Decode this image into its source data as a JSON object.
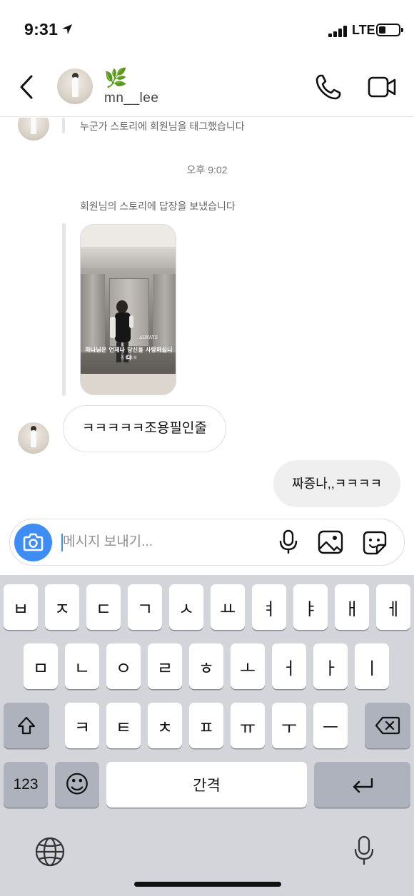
{
  "status_bar": {
    "time": "9:31",
    "network": "LTE"
  },
  "header": {
    "username": "mn__lee",
    "leaf_emoji": "🌿"
  },
  "chat": {
    "tag_notice": "누군가 스토리에 회원님을 태그했습니다",
    "timestamp": "오후 9:02",
    "reply_notice": "회원님의 스토리에 답장을 보냈습니다",
    "story_caption": "하나님은 언제나 당신을 사랑하십니다",
    "story_sub": "중 앙 대 회",
    "story_badge": "ALWAYS",
    "received_message": "ㅋㅋㅋㅋㅋ조용필인줄",
    "sent_message": "짜증나,,ㅋㅋㅋㅋ"
  },
  "composer": {
    "placeholder": "메시지 보내기..."
  },
  "keyboard": {
    "row1": [
      "ㅂ",
      "ㅈ",
      "ㄷ",
      "ㄱ",
      "ㅅ",
      "ㅛ",
      "ㅕ",
      "ㅑ",
      "ㅐ",
      "ㅔ"
    ],
    "row2": [
      "ㅁ",
      "ㄴ",
      "ㅇ",
      "ㄹ",
      "ㅎ",
      "ㅗ",
      "ㅓ",
      "ㅏ",
      "ㅣ"
    ],
    "row3": [
      "ㅋ",
      "ㅌ",
      "ㅊ",
      "ㅍ",
      "ㅠ",
      "ㅜ",
      "ㅡ"
    ],
    "numbers_key": "123",
    "space_key": "간격",
    "emoji_key": "☺"
  },
  "icons": {
    "back": "chevron-left-icon",
    "call": "phone-icon",
    "video": "video-camera-icon",
    "camera": "camera-icon",
    "mic": "microphone-icon",
    "gallery": "image-icon",
    "sticker": "sticker-icon",
    "shift": "shift-icon",
    "delete": "backspace-icon",
    "return": "return-icon",
    "globe": "globe-icon"
  },
  "colors": {
    "accent": "#3d8df5",
    "keyboard_bg": "#d3d5db",
    "sent_bubble": "#efefef"
  }
}
